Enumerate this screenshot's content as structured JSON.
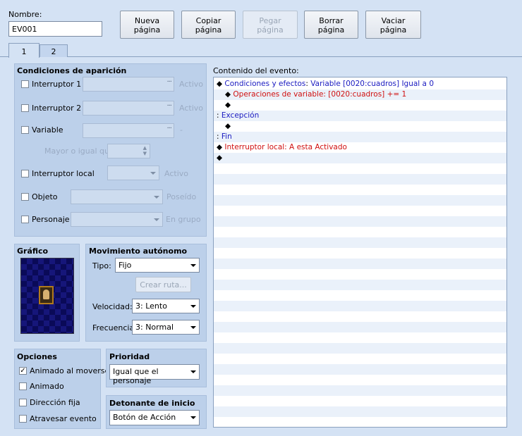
{
  "header": {
    "name_label": "Nombre:",
    "name_value": "EV001",
    "buttons": [
      {
        "label": "Nueva\npágina",
        "enabled": true
      },
      {
        "label": "Copiar\npágina",
        "enabled": true
      },
      {
        "label": "Pegar\npágina",
        "enabled": false
      },
      {
        "label": "Borrar\npágina",
        "enabled": true
      },
      {
        "label": "Vaciar\npágina",
        "enabled": true
      }
    ]
  },
  "tabs": [
    "1",
    "2"
  ],
  "conditions": {
    "title": "Condiciones de aparición",
    "switch1_label": "Interruptor 1",
    "switch1_state": "Activo",
    "switch2_label": "Interruptor 2",
    "switch2_state": "Activo",
    "variable_label": "Variable",
    "variable_suffix": "-",
    "variable_compare": "Mayor o igual que",
    "self_switch_label": "Interruptor local",
    "self_switch_state": "Activo",
    "item_label": "Objeto",
    "item_state": "Poseído",
    "actor_label": "Personaje",
    "actor_state": "En grupo"
  },
  "graphic": {
    "title": "Gráfico"
  },
  "movement": {
    "title": "Movimiento autónomo",
    "type_label": "Tipo:",
    "type_value": "Fijo",
    "route_button": "Crear ruta...",
    "speed_label": "Velocidad:",
    "speed_value": "3: Lento",
    "freq_label": "Frecuencia:",
    "freq_value": "3: Normal"
  },
  "options": {
    "title": "Opciones",
    "items": [
      {
        "label": "Animado al moverse",
        "checked": true
      },
      {
        "label": "Animado",
        "checked": false
      },
      {
        "label": "Dirección fija",
        "checked": false
      },
      {
        "label": "Atravesar evento",
        "checked": false
      }
    ]
  },
  "priority": {
    "title": "Prioridad",
    "value": "Igual que el personaje"
  },
  "trigger": {
    "title": "Detonante de inicio",
    "value": "Botón de Acción"
  },
  "contents": {
    "title": "Contenido del evento:",
    "lines": [
      {
        "indent": 0,
        "bullet": "◆",
        "parts": [
          {
            "text": "Condiciones y efectos",
            "color": "blue"
          },
          {
            "text": ": ",
            "color": "black"
          },
          {
            "text": "Variable [0020:cuadros] Igual a 0",
            "color": "blue"
          }
        ]
      },
      {
        "indent": 1,
        "bullet": "◆",
        "parts": [
          {
            "text": "Operaciones de variable: [0020:cuadros] += 1",
            "color": "red"
          }
        ]
      },
      {
        "indent": 1,
        "bullet": "◆",
        "parts": []
      },
      {
        "indent": 0,
        "bullet": ":",
        "parts": [
          {
            "text": "Excepción",
            "color": "blue"
          }
        ]
      },
      {
        "indent": 1,
        "bullet": "◆",
        "parts": []
      },
      {
        "indent": 0,
        "bullet": ":",
        "parts": [
          {
            "text": "Fin",
            "color": "blue"
          }
        ]
      },
      {
        "indent": 0,
        "bullet": "◆",
        "parts": [
          {
            "text": "Interruptor local: A esta Activado",
            "color": "red"
          }
        ]
      },
      {
        "indent": 0,
        "bullet": "◆",
        "parts": []
      }
    ]
  },
  "colors": {
    "background": "#d4e2f4",
    "panel": "#bcd0ea",
    "blue_text": "#1a1ac0",
    "red_text": "#d01010"
  }
}
